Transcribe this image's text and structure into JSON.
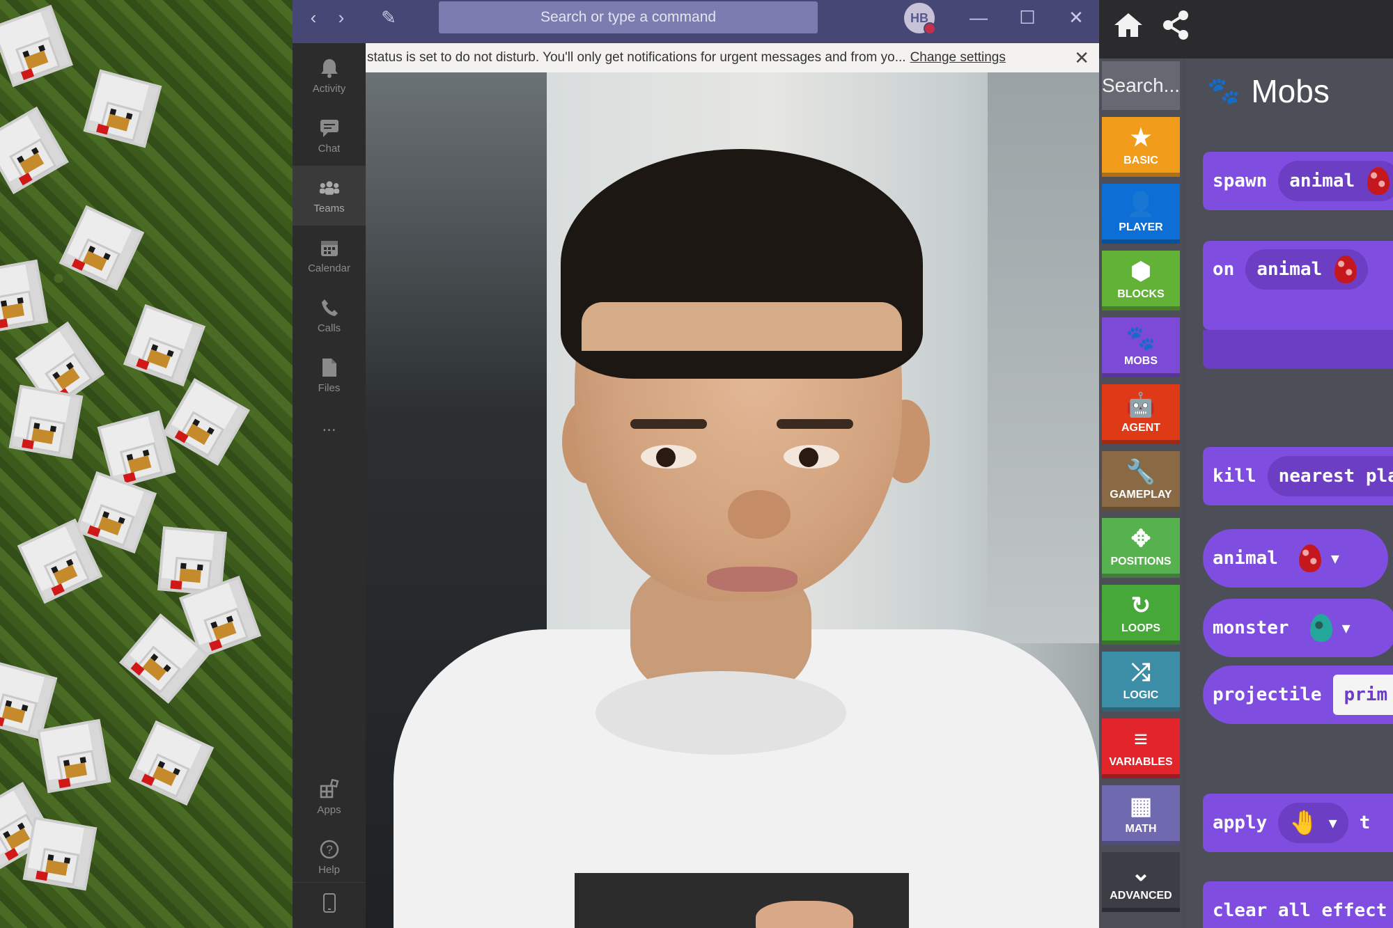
{
  "teams": {
    "search_placeholder": "Search or type a command",
    "avatar_initials": "HB",
    "nav": {
      "back": "‹",
      "forward": "›",
      "compose": "✎"
    },
    "window_controls": {
      "minimize": "—",
      "maximize": "☐",
      "close": "✕"
    },
    "rail": [
      {
        "label": "Activity",
        "icon": "bell-icon"
      },
      {
        "label": "Chat",
        "icon": "chat-icon"
      },
      {
        "label": "Teams",
        "icon": "teams-icon"
      },
      {
        "label": "Calendar",
        "icon": "calendar-icon"
      },
      {
        "label": "Calls",
        "icon": "phone-icon"
      },
      {
        "label": "Files",
        "icon": "file-icon"
      },
      {
        "label": "...",
        "icon": "more-icon"
      },
      {
        "label": "Apps",
        "icon": "apps-icon"
      },
      {
        "label": "Help",
        "icon": "help-icon"
      }
    ],
    "banner": {
      "text": "status is set to do not disturb. You'll only get notifications for urgent messages and from yo...",
      "link": "Change settings",
      "close": "✕"
    },
    "colors": {
      "titlebar": "#464775",
      "rail": "#2d2c2c"
    }
  },
  "makecode": {
    "header_icons": [
      "home-icon",
      "share-icon"
    ],
    "search_placeholder": "Search...",
    "categories": [
      {
        "label": "BASIC",
        "color": "#f19d1b",
        "glyph": "★"
      },
      {
        "label": "PLAYER",
        "color": "#0d6fd6",
        "glyph": "👤"
      },
      {
        "label": "BLOCKS",
        "color": "#62b238",
        "glyph": "⬢"
      },
      {
        "label": "MOBS",
        "color": "#7c4ad6",
        "glyph": "🐾"
      },
      {
        "label": "AGENT",
        "color": "#df3a18",
        "glyph": "🤖"
      },
      {
        "label": "GAMEPLAY",
        "color": "#8a6a44",
        "glyph": "🔧"
      },
      {
        "label": "POSITIONS",
        "color": "#56b14f",
        "glyph": "✥"
      },
      {
        "label": "LOOPS",
        "color": "#47a83a",
        "glyph": "↻"
      },
      {
        "label": "LOGIC",
        "color": "#3b8ea5",
        "glyph": "⤮"
      },
      {
        "label": "VARIABLES",
        "color": "#e1252b",
        "glyph": "≡"
      },
      {
        "label": "MATH",
        "color": "#6f69b0",
        "glyph": "▦"
      },
      {
        "label": "ADVANCED",
        "color": "#3c3d45",
        "glyph": "⌄"
      }
    ],
    "flyout_title": "Mobs",
    "blocks": {
      "spawn": {
        "keyword": "spawn",
        "slot": "animal"
      },
      "on": {
        "keyword": "on",
        "slot": "animal"
      },
      "kill": {
        "keyword": "kill",
        "slot": "nearest pla"
      },
      "animal": {
        "keyword": "animal"
      },
      "monster": {
        "keyword": "monster"
      },
      "projectile": {
        "keyword": "projectile",
        "slot": "prim"
      },
      "apply": {
        "keyword": "apply",
        "tail": "t"
      },
      "clear": {
        "keyword": "clear all effect"
      }
    },
    "block_color": "#7f4de0"
  }
}
